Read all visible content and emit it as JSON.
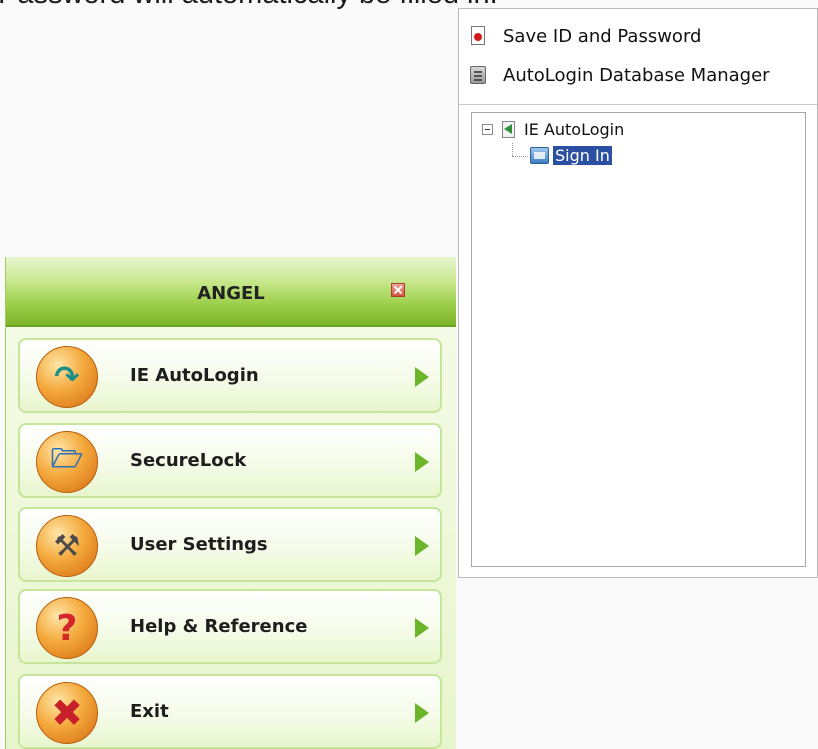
{
  "caption": "Password will automatically be filled in.",
  "right_panel": {
    "menu": [
      {
        "label": "Save ID and Password",
        "icon": "document-icon"
      },
      {
        "label": "AutoLogin Database Manager",
        "icon": "database-icon"
      }
    ],
    "tree": {
      "root": {
        "label": "IE AutoLogin",
        "icon": "ie-autologin-icon",
        "expanded": true
      },
      "children": [
        {
          "label": "Sign In",
          "icon": "signin-icon",
          "selected": true
        }
      ]
    }
  },
  "angel": {
    "title": "ANGEL",
    "accent_color": "#8cc63f",
    "items": [
      {
        "label": "IE AutoLogin",
        "icon": "download-arrow-icon"
      },
      {
        "label": "SecureLock",
        "icon": "folder-lock-icon"
      },
      {
        "label": "User Settings",
        "icon": "tools-icon"
      },
      {
        "label": "Help & Reference",
        "icon": "question-icon"
      },
      {
        "label": "Exit",
        "icon": "x-icon"
      }
    ]
  }
}
